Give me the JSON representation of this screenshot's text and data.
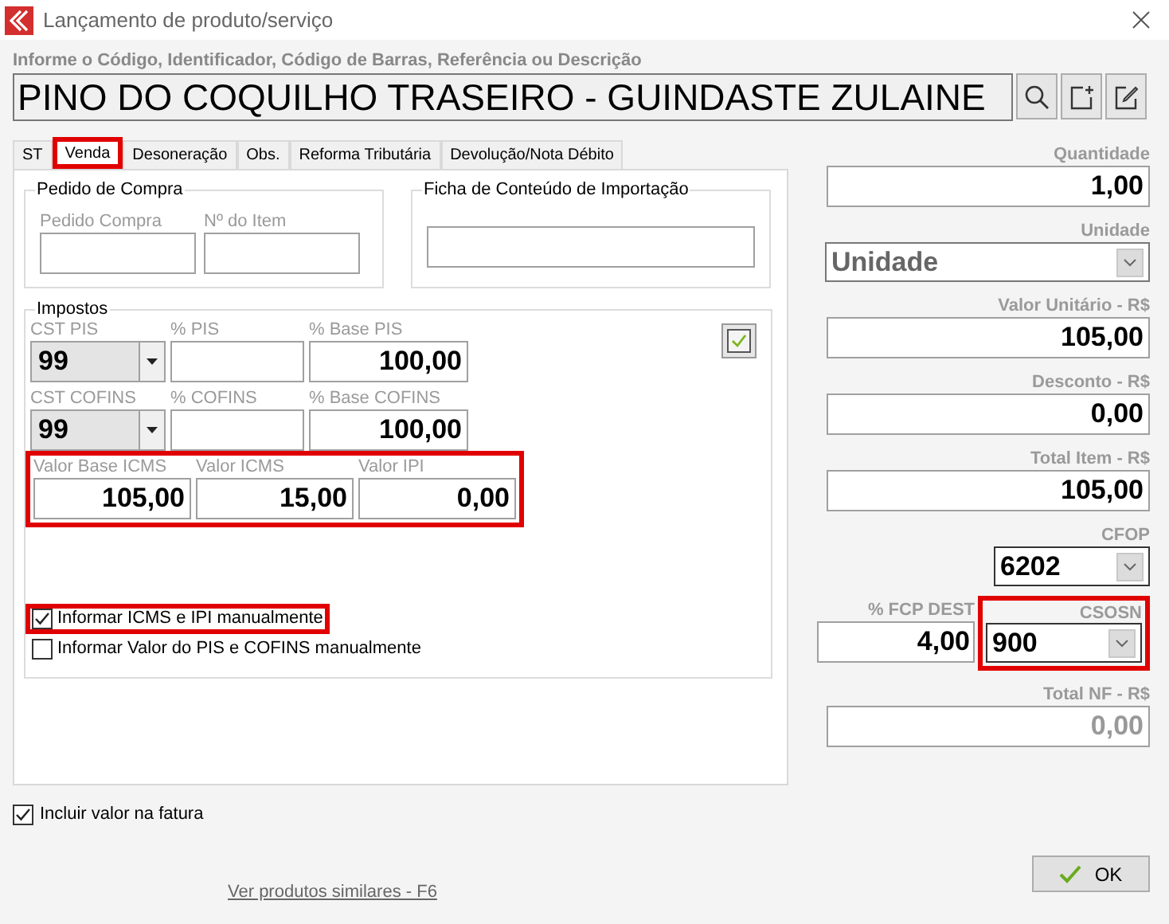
{
  "window": {
    "title": "Lançamento de produto/serviço"
  },
  "search": {
    "label": "Informe o Código, Identificador, Código de Barras, Referência ou Descrição",
    "value": "PINO DO COQUILHO TRASEIRO - GUINDASTE ZULAINE"
  },
  "tabs": [
    {
      "label": "ST",
      "selected": false,
      "highlighted": false
    },
    {
      "label": "Venda",
      "selected": true,
      "highlighted": true
    },
    {
      "label": "Desoneração",
      "selected": false,
      "highlighted": false
    },
    {
      "label": "Obs.",
      "selected": false,
      "highlighted": false
    },
    {
      "label": "Reforma Tributária",
      "selected": false,
      "highlighted": false
    },
    {
      "label": "Devolução/Nota Débito",
      "selected": false,
      "highlighted": false
    }
  ],
  "purchase_order": {
    "title": "Pedido de Compra",
    "fields": [
      {
        "label": "Pedido Compra"
      },
      {
        "label": "Nº do Item"
      }
    ]
  },
  "import_sheet": {
    "title": "Ficha de Conteúdo de Importação"
  },
  "taxes": {
    "title": "Impostos",
    "confirm_checked": true,
    "rows": [
      [
        {
          "kind": "select",
          "label": "CST PIS",
          "value": "99"
        },
        {
          "kind": "input",
          "label": "% PIS"
        },
        {
          "kind": "input",
          "label": "% Base PIS",
          "value": "100,00"
        }
      ],
      [
        {
          "kind": "select",
          "label": "CST COFINS",
          "value": "99"
        },
        {
          "kind": "input",
          "label": "% COFINS"
        },
        {
          "kind": "input",
          "label": "% Base COFINS",
          "value": "100,00"
        }
      ]
    ],
    "icms": {
      "highlighted": true,
      "fields": [
        {
          "label": "Valor Base ICMS",
          "value": "105,00"
        },
        {
          "label": "Valor ICMS",
          "value": "15,00"
        },
        {
          "label": "Valor IPI",
          "value": "0,00"
        }
      ]
    },
    "options": [
      {
        "label": "Informar ICMS e IPI manualmente",
        "checked": true,
        "highlighted": true
      },
      {
        "label": "Informar Valor do PIS e COFINS manualmente",
        "checked": false,
        "highlighted": false
      }
    ]
  },
  "right_fields": [
    {
      "kind": "input",
      "label": "Quantidade",
      "value": "1,00",
      "disabled": false
    },
    {
      "kind": "select",
      "label": "Unidade",
      "value": "Unidade",
      "disabled": true
    },
    {
      "kind": "input",
      "label": "Valor Unitário - R$",
      "value": "105,00",
      "disabled": false
    },
    {
      "kind": "input",
      "label": "Desconto - R$",
      "value": "0,00",
      "disabled": false
    },
    {
      "kind": "input",
      "label": "Total Item - R$",
      "value": "105,00",
      "disabled": false
    },
    {
      "kind": "small_select",
      "label": "CFOP",
      "value": "6202",
      "highlighted": false
    },
    {
      "kind": "split",
      "left": {
        "label": "% FCP DEST",
        "value": "4,00"
      },
      "right": {
        "label": "CSOSN",
        "value": "900",
        "highlighted": true
      }
    },
    {
      "kind": "input",
      "label": "Total NF - R$",
      "value": "0,00",
      "disabled": true
    }
  ],
  "include_invoice": {
    "label": "Incluir valor na fatura",
    "checked": true
  },
  "similar_link": "Ver produtos similares - F6",
  "ok_button": "OK"
}
